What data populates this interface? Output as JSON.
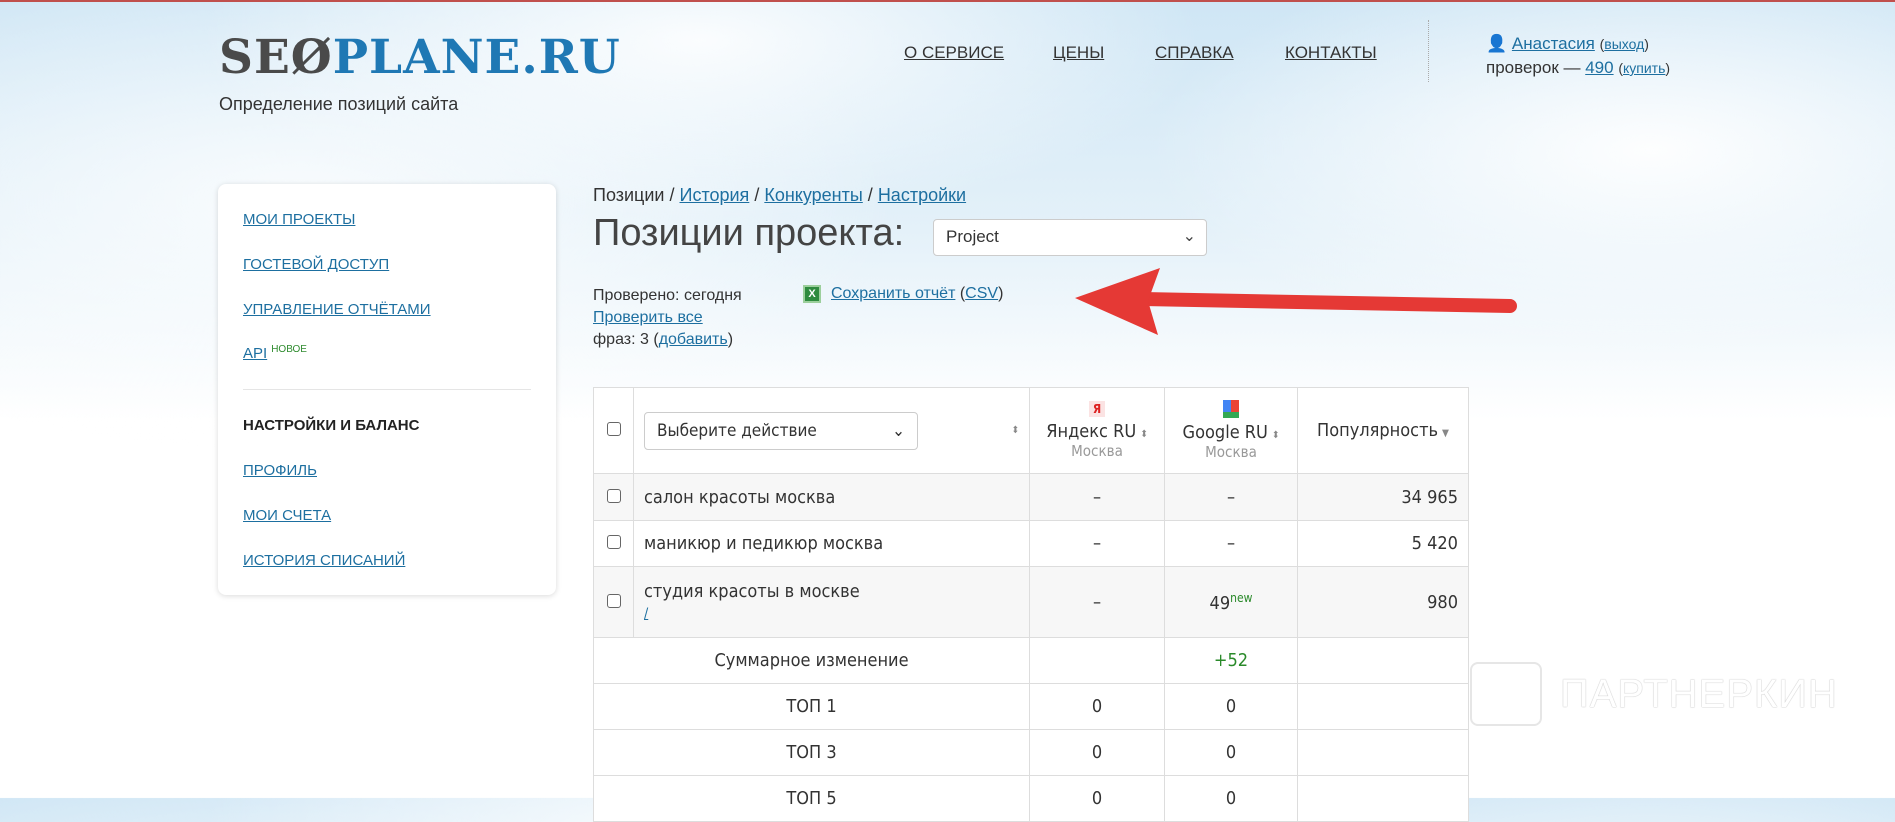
{
  "header": {
    "logo_left": "SE",
    "logo_right": "PLANE.RU",
    "tagline": "Определение позиций сайта",
    "nav": [
      "О СЕРВИСЕ",
      "ЦЕНЫ",
      "СПРАВКА",
      "КОНТАКТЫ"
    ],
    "user": {
      "name": "Анастасия",
      "logout": "выход",
      "checks_label": "проверок —",
      "checks": "490",
      "buy": "купить"
    }
  },
  "sidebar": {
    "items": [
      "Мои проекты",
      "Гостевой доступ",
      "Управление отчётами",
      "API"
    ],
    "api_badge": "новое",
    "section": "Настройки и баланс",
    "section_items": [
      "Профиль",
      "Мои счета",
      "История списаний"
    ]
  },
  "breadcrumb": {
    "current": "Позиции",
    "links": [
      "История",
      "Конкуренты",
      "Настройки"
    ],
    "sep": "/"
  },
  "title": "Позиции проекта:",
  "project_select": "Project",
  "info": {
    "checked": "Проверено: сегодня",
    "check_all": "Проверить все",
    "phrases": "фраз: 3",
    "add": "добавить",
    "save": "Сохранить отчёт",
    "csv": "CSV"
  },
  "table": {
    "action_placeholder": "Выберите действие",
    "columns": [
      {
        "name": "Яндекс RU",
        "region": "Москва"
      },
      {
        "name": "Google RU",
        "region": "Москва"
      },
      {
        "name": "Популярность"
      }
    ],
    "rows": [
      {
        "phrase": "салон красоты москва",
        "yandex": "–",
        "google": "–",
        "pop": "34 965"
      },
      {
        "phrase": "маникюр и педикюр москва",
        "yandex": "–",
        "google": "–",
        "pop": "5 420"
      },
      {
        "phrase": "студия красоты в москве",
        "url": "/",
        "yandex": "–",
        "google": "49",
        "google_badge": "new",
        "pop": "980"
      }
    ],
    "summary": [
      {
        "label": "Суммарное изменение",
        "yandex": "",
        "google": "+52"
      },
      {
        "label": "ТОП 1",
        "yandex": "0",
        "google": "0"
      },
      {
        "label": "ТОП 3",
        "yandex": "0",
        "google": "0"
      },
      {
        "label": "ТОП 5",
        "yandex": "0",
        "google": "0"
      }
    ]
  },
  "watermark": "ПАРТНЕРКИН"
}
